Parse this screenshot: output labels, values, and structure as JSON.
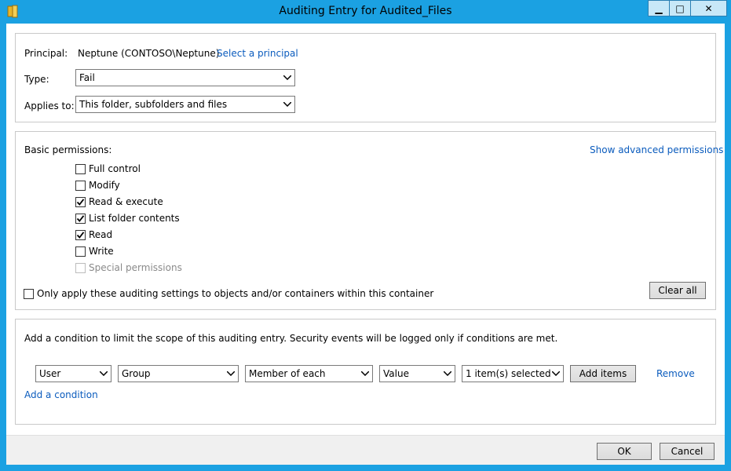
{
  "window": {
    "title": "Auditing Entry for Audited_Files",
    "minimize_glyph": "▁",
    "maximize_glyph": "□",
    "close_glyph": "✕"
  },
  "principal": {
    "label": "Principal:",
    "value": "Neptune (CONTOSO\\Neptune)",
    "select_link": "Select a principal"
  },
  "type": {
    "label": "Type:",
    "value": "Fail"
  },
  "applies_to": {
    "label": "Applies to:",
    "value": "This folder, subfolders and files"
  },
  "permissions": {
    "heading": "Basic permissions:",
    "advanced_link": "Show advanced permissions",
    "items": [
      {
        "label": "Full control",
        "checked": false,
        "disabled": false
      },
      {
        "label": "Modify",
        "checked": false,
        "disabled": false
      },
      {
        "label": "Read & execute",
        "checked": true,
        "disabled": false
      },
      {
        "label": "List folder contents",
        "checked": true,
        "disabled": false
      },
      {
        "label": "Read",
        "checked": true,
        "disabled": false
      },
      {
        "label": "Write",
        "checked": false,
        "disabled": false
      },
      {
        "label": "Special permissions",
        "checked": false,
        "disabled": true
      }
    ],
    "only_apply_label": "Only apply these auditing settings to objects and/or containers within this container",
    "only_apply_checked": false,
    "clear_all": "Clear all"
  },
  "condition": {
    "description": "Add a condition to limit the scope of this auditing entry. Security events will be logged only if conditions are met.",
    "attribute_source": "User",
    "attribute": "Group",
    "operator": "Member of each",
    "value_type": "Value",
    "value": "1 item(s) selected",
    "add_items": "Add items",
    "remove": "Remove",
    "add_condition": "Add a condition"
  },
  "footer": {
    "ok": "OK",
    "cancel": "Cancel"
  }
}
